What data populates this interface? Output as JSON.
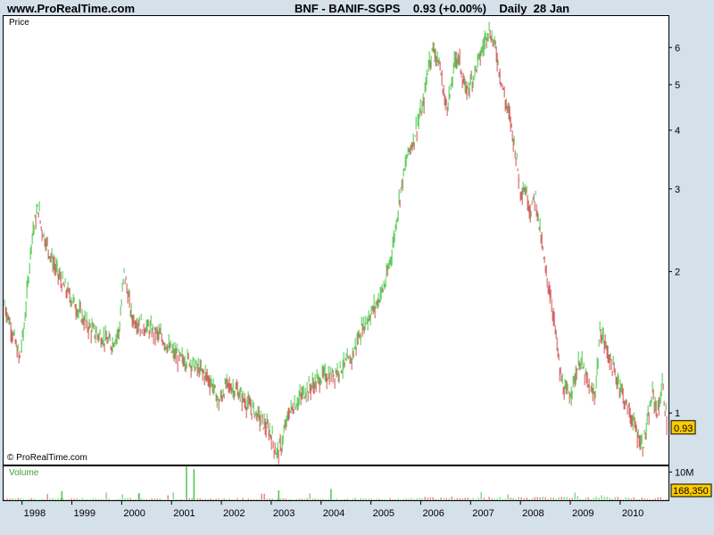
{
  "header": {
    "site": "www.ProRealTime.com",
    "title": "BNF - BANIF-SGPS    0.93 (+0.00%)    Daily  28 Jan"
  },
  "price_panel": {
    "label": "Price",
    "copyright": "© ProRealTime.com",
    "last_value": "0.93"
  },
  "volume_panel": {
    "label": "Volume",
    "tick": "10M",
    "last_value": "168,350"
  },
  "colors": {
    "up": "#4cc84c",
    "down": "#d05050",
    "last_box": "#ffcc00",
    "background": "#d4e0ea"
  },
  "chart_data": {
    "type": "line",
    "scale": "log",
    "ylim": [
      0.78,
      7.0
    ],
    "yticks": [
      1,
      2,
      3,
      4,
      5,
      6
    ],
    "x_labels": [
      "1998",
      "1999",
      "2000",
      "2001",
      "2002",
      "2003",
      "2004",
      "2005",
      "2006",
      "2007",
      "2008",
      "2009",
      "2010"
    ],
    "series": [
      {
        "x": [
          1997.65,
          1997.8,
          1997.95,
          1998.05,
          1998.2,
          1998.33,
          1998.38,
          1998.55,
          1998.7,
          1998.85,
          1999.0,
          1999.2,
          1999.4,
          1999.6,
          1999.8,
          1999.95,
          2000.05,
          2000.2,
          2000.35,
          2000.6,
          2000.8,
          2001.0,
          2001.2,
          2001.35,
          2001.5,
          2001.7,
          2001.82,
          2001.95,
          2002.1,
          2002.3,
          2002.5,
          2002.7,
          2002.85,
          2003.0,
          2003.1,
          2003.2,
          2003.35,
          2003.5,
          2003.7,
          2003.85,
          2004.05,
          2004.2,
          2004.4,
          2004.6,
          2004.8,
          2004.95,
          2005.1,
          2005.3,
          2005.45,
          2005.6,
          2005.75,
          2005.85,
          2005.95,
          2006.05,
          2006.15,
          2006.25,
          2006.38,
          2006.5,
          2006.6,
          2006.7,
          2006.78,
          2006.9,
          2007.05,
          2007.15,
          2007.25,
          2007.35,
          2007.5,
          2007.6,
          2007.7,
          2007.8,
          2007.9,
          2008.0,
          2008.1,
          2008.2,
          2008.3,
          2008.38,
          2008.5,
          2008.6,
          2008.7,
          2008.8,
          2008.9,
          2009.0,
          2009.1,
          2009.2,
          2009.3,
          2009.4,
          2009.5,
          2009.6,
          2009.7,
          2009.8,
          2009.9,
          2010.0,
          2010.1,
          2010.2,
          2010.35,
          2010.45,
          2010.55,
          2010.65,
          2010.75,
          2010.85,
          2010.95
        ],
        "y": [
          1.7,
          1.5,
          1.3,
          1.55,
          2.4,
          2.75,
          2.5,
          2.2,
          2.0,
          1.85,
          1.75,
          1.6,
          1.5,
          1.45,
          1.4,
          1.5,
          2.0,
          1.6,
          1.55,
          1.5,
          1.45,
          1.35,
          1.3,
          1.3,
          1.25,
          1.2,
          1.15,
          1.05,
          1.15,
          1.12,
          1.05,
          1.0,
          0.95,
          0.9,
          0.82,
          0.85,
          1.0,
          1.05,
          1.12,
          1.15,
          1.2,
          1.2,
          1.25,
          1.3,
          1.5,
          1.6,
          1.7,
          1.9,
          2.3,
          3.0,
          3.6,
          3.8,
          4.2,
          4.5,
          5.5,
          6.0,
          5.5,
          4.5,
          4.8,
          5.8,
          5.6,
          4.8,
          5.2,
          5.6,
          6.0,
          6.6,
          6.0,
          5.2,
          4.6,
          4.2,
          3.6,
          3.0,
          3.0,
          2.7,
          2.9,
          2.5,
          2.0,
          1.8,
          1.5,
          1.2,
          1.1,
          1.1,
          1.2,
          1.3,
          1.2,
          1.1,
          1.1,
          1.5,
          1.4,
          1.3,
          1.2,
          1.15,
          1.05,
          1.0,
          0.9,
          0.85,
          0.95,
          1.1,
          1.0,
          1.15,
          0.93
        ]
      }
    ],
    "volume": {
      "ylim": [
        0,
        12000000
      ],
      "tick_label": "10M"
    }
  }
}
